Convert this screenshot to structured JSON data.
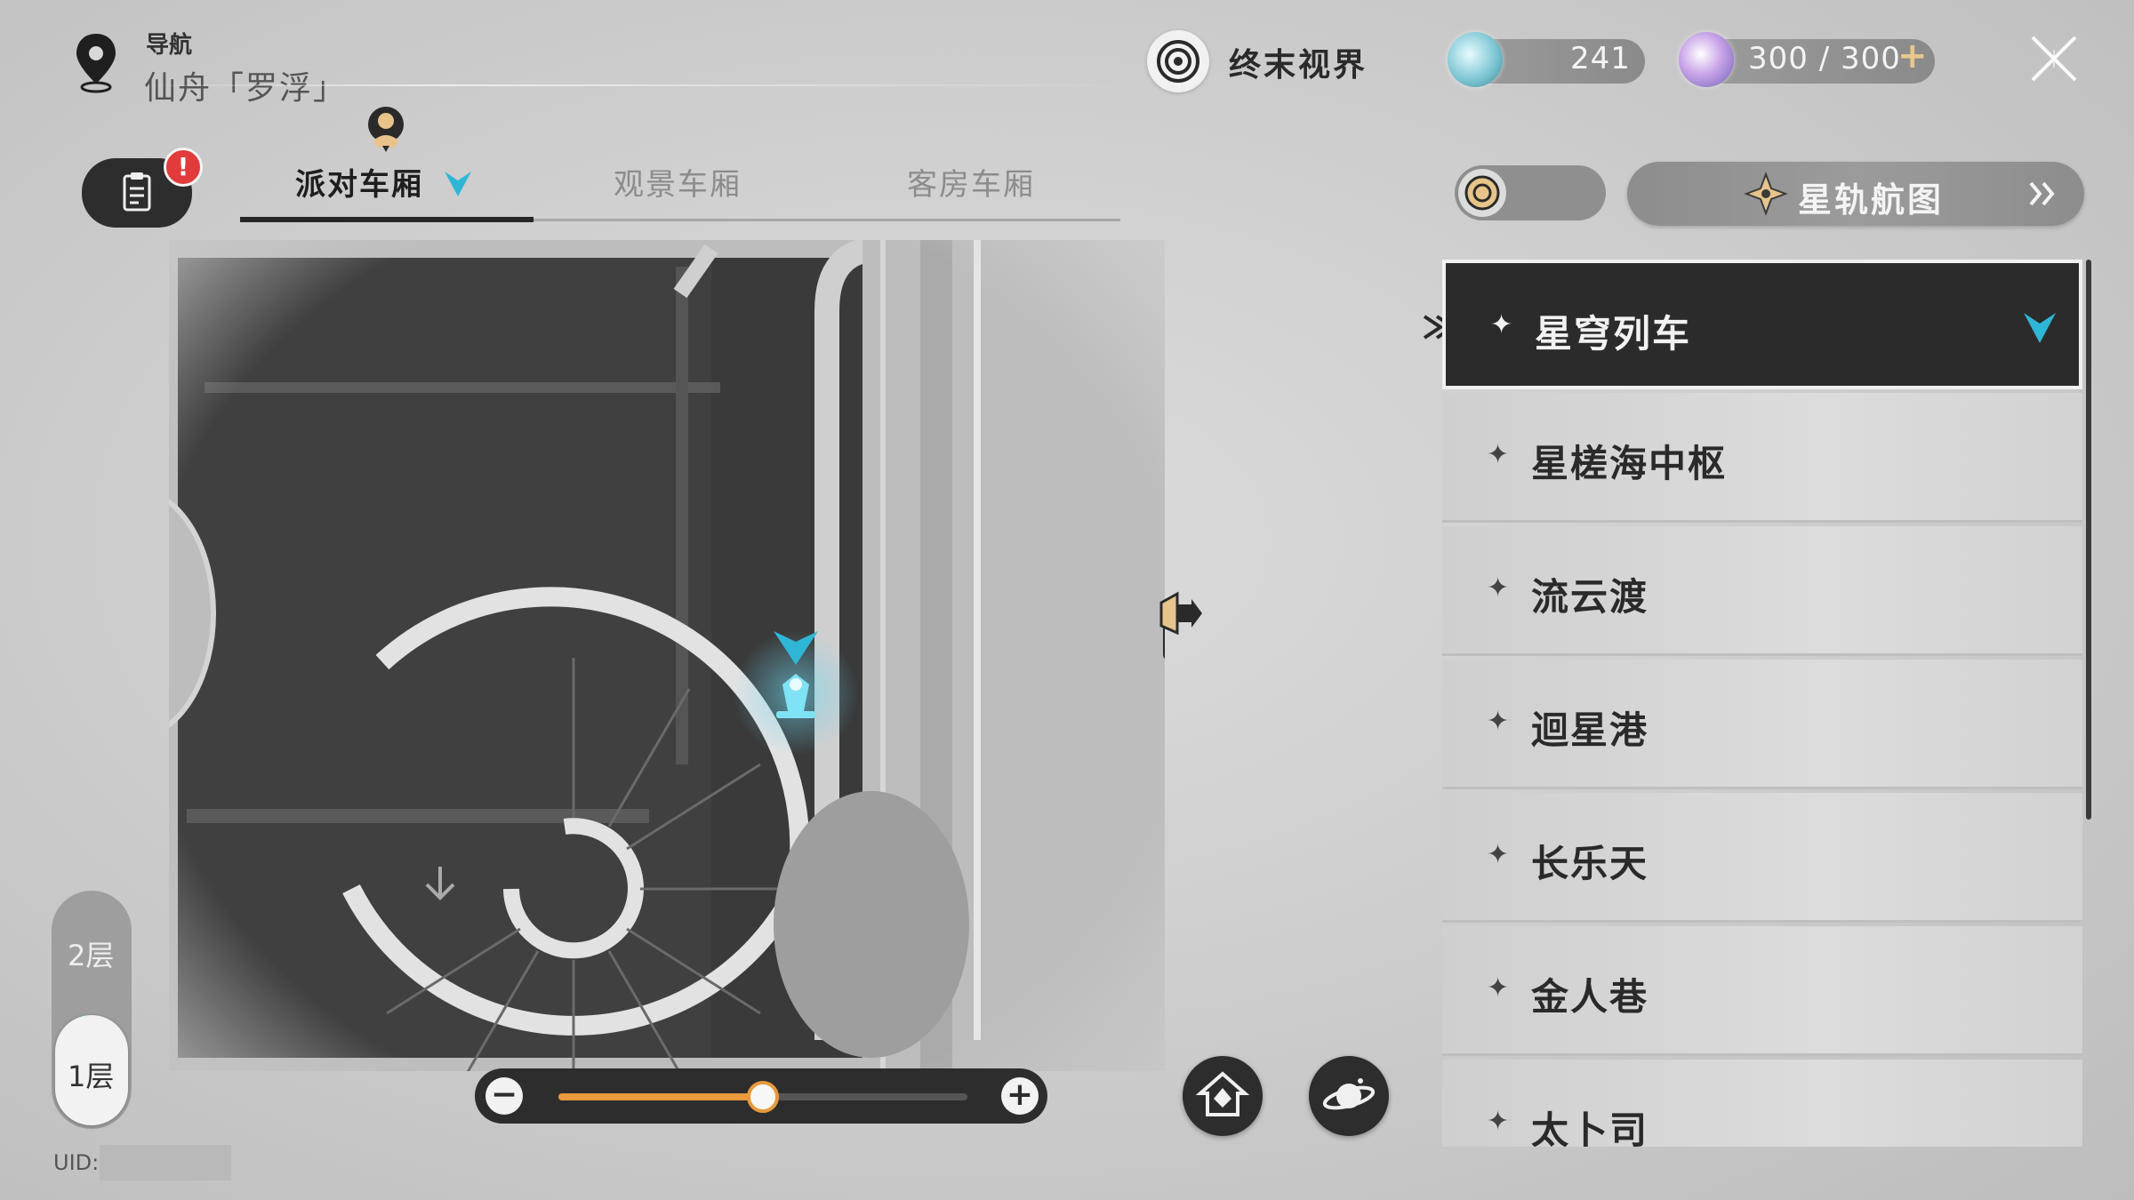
{
  "header": {
    "nav_small": "导航",
    "location": "仙舟「罗浮」",
    "realm_label": "终末视界",
    "icons": [
      "location-pin-icon",
      "realm-icon",
      "close-icon"
    ]
  },
  "resources": {
    "stellar_jade": "241",
    "trailblaze_power": "300 / 300",
    "add": "+"
  },
  "mission_badge": "!",
  "tabs": [
    {
      "label": "派对车厢",
      "active": true
    },
    {
      "label": "观景车厢",
      "active": false
    },
    {
      "label": "客房车厢",
      "active": false
    }
  ],
  "floors": {
    "upper": "2层",
    "current": "1层"
  },
  "zoom": {
    "minus": "−",
    "plus": "+",
    "level": 0.5
  },
  "uid_label": "UID:",
  "starmap": {
    "label": "星轨航图"
  },
  "locations": [
    {
      "name": "星穹列车",
      "selected": true
    },
    {
      "name": "星槎海中枢",
      "selected": false
    },
    {
      "name": "流云渡",
      "selected": false
    },
    {
      "name": "迴星港",
      "selected": false
    },
    {
      "name": "长乐天",
      "selected": false
    },
    {
      "name": "金人巷",
      "selected": false
    },
    {
      "name": "太卜司",
      "selected": false
    }
  ],
  "colors": {
    "accent_blue": "#2fb6d6",
    "orange": "#e89a3c",
    "dark": "#2d2d2d",
    "badge_red": "#e23b3b"
  }
}
